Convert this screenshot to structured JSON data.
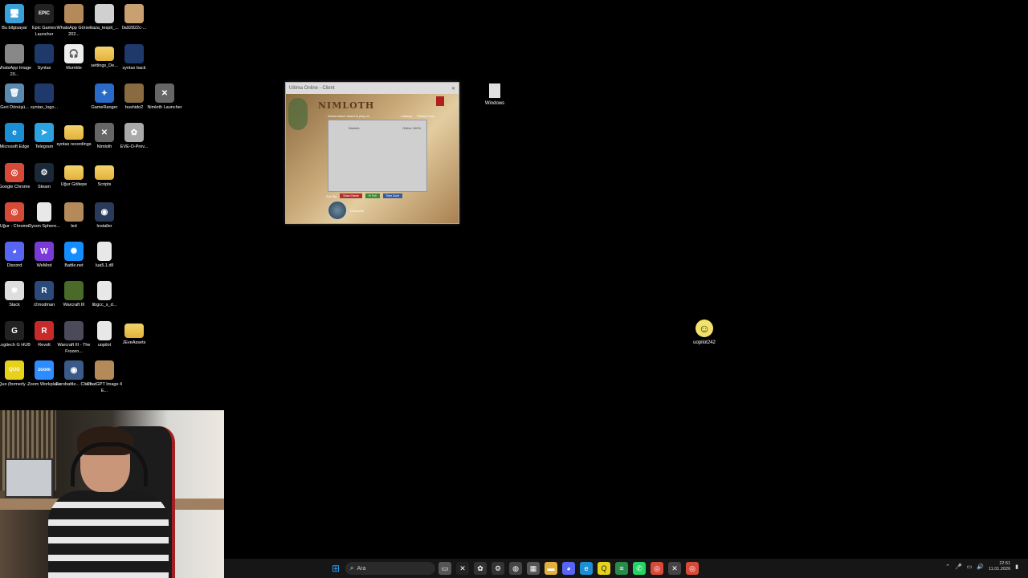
{
  "desktop_icons": [
    {
      "label": "Bu bilgisayar",
      "glyph": "🖥",
      "color": "#3aa0d8"
    },
    {
      "label": "Epic Games Launcher",
      "glyph": "EPIC",
      "color": "#222"
    },
    {
      "label": "WhatsApp Görsel 202...",
      "glyph": "",
      "color": "#b58a5a"
    },
    {
      "label": "kaza_tespit_...",
      "glyph": "",
      "color": "#d0d0d0"
    },
    {
      "label": "0a92822c-...",
      "glyph": "",
      "color": "#c9a070"
    },
    {
      "label": "WhatsApp Image 20...",
      "glyph": "",
      "color": "#888"
    },
    {
      "label": "Syntax",
      "glyph": "",
      "color": "#1f3a6a"
    },
    {
      "label": "Mumble",
      "glyph": "🎧",
      "color": "#eee"
    },
    {
      "label": "settings_De...",
      "glyph": "",
      "color": "folder"
    },
    {
      "label": "syntax back",
      "glyph": "",
      "color": "#1f3a6a"
    },
    {
      "label": "Geri Dönüşü...",
      "glyph": "🗑",
      "color": "#5a8ab0"
    },
    {
      "label": "syntax_logo...",
      "glyph": "",
      "color": "#1f3a6a"
    },
    {
      "label": "GameRanger",
      "glyph": "✦",
      "color": "#2a6ac8"
    },
    {
      "label": "bushido2",
      "glyph": "",
      "color": "#8a6a40"
    },
    {
      "label": "Nimloth Launcher",
      "glyph": "✕",
      "color": "#666"
    },
    {
      "label": "Microsoft Edge",
      "glyph": "e",
      "color": "#1a8fd6"
    },
    {
      "label": "Telegram",
      "glyph": "➤",
      "color": "#2aa3e0"
    },
    {
      "label": "syntax recordings",
      "glyph": "",
      "color": "folder"
    },
    {
      "label": "Nimloth",
      "glyph": "✕",
      "color": "#666"
    },
    {
      "label": "EVE-O-Prev...",
      "glyph": "✿",
      "color": "#aaa"
    },
    {
      "label": "Google Chrome",
      "glyph": "◎",
      "color": "#d84a38"
    },
    {
      "label": "Steam",
      "glyph": "⚙",
      "color": "#1b2838"
    },
    {
      "label": "Uğur Göltepe",
      "glyph": "",
      "color": "folder"
    },
    {
      "label": "Scripts",
      "glyph": "",
      "color": "folder"
    },
    {
      "label": "Uğur - Chrome",
      "glyph": "◎",
      "color": "#d84a38"
    },
    {
      "label": "Dyson Sphere...",
      "glyph": "",
      "color": "file"
    },
    {
      "label": "led",
      "glyph": "",
      "color": "#b58a5a"
    },
    {
      "label": "Installer",
      "glyph": "◉",
      "color": "#2a3a5a"
    },
    {
      "label": "Discord",
      "glyph": "◕",
      "color": "#5865f2"
    },
    {
      "label": "WeMod",
      "glyph": "W",
      "color": "#7a3ad8"
    },
    {
      "label": "Battle.net",
      "glyph": "✺",
      "color": "#148eff"
    },
    {
      "label": "lua5.1.dll",
      "glyph": "",
      "color": "file"
    },
    {
      "label": "Slack",
      "glyph": "✱",
      "color": "#ddd"
    },
    {
      "label": "r2modman",
      "glyph": "R",
      "color": "#2a4a7a"
    },
    {
      "label": "Warcraft III",
      "glyph": "",
      "color": "#4a6a2a"
    },
    {
      "label": "libgcc_s_d...",
      "glyph": "",
      "color": "file"
    },
    {
      "label": "Logitech G HUB",
      "glyph": "G",
      "color": "#222"
    },
    {
      "label": "Revolt",
      "glyph": "R",
      "color": "#c82a2a"
    },
    {
      "label": "Warcraft III - The Frozen...",
      "glyph": "",
      "color": "#4a4a5a"
    },
    {
      "label": "uopilot",
      "glyph": "",
      "color": "file"
    },
    {
      "label": "JEveAssets",
      "glyph": "",
      "color": "folder"
    },
    {
      "label": "Quo (formerly ...",
      "glyph": "QUO",
      "color": "#e6d21a"
    },
    {
      "label": "Zoom Workplace",
      "glyph": "zoom",
      "color": "#2d8cff"
    },
    {
      "label": "Eurobattle... Client",
      "glyph": "◉",
      "color": "#3a5a8a"
    },
    {
      "label": "ChatGPT Image 4 E...",
      "glyph": "",
      "color": "#b58a5a"
    }
  ],
  "game_window": {
    "title": "Ultima Online - Client",
    "logo": "NIMLOTH",
    "instruction": "Select which shard to play on",
    "links": [
      "Latency",
      "Packet Loss"
    ],
    "server_name": "Nimloth",
    "server_status": "Online 100%",
    "buttons": [
      "Sort By",
      "Shard Name",
      "% Full",
      "Time Zone"
    ],
    "user": "Character"
  },
  "desktop_file": {
    "label": "Windows"
  },
  "smiley": {
    "label": "uopilot242"
  },
  "taskbar": {
    "search_placeholder": "Ara",
    "clock_time": "22:51",
    "clock_date": "11.01.2026"
  }
}
